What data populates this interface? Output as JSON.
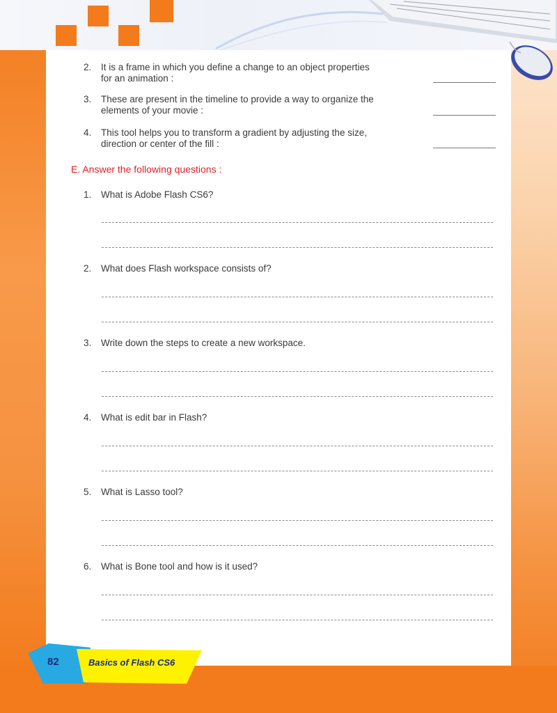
{
  "fill_blanks": [
    {
      "number": "2.",
      "line1": "It is a frame in which you define a change to an object properties",
      "line2": "for an animation :"
    },
    {
      "number": "3.",
      "line1": "These are present in the timeline to provide a way to organize the",
      "line2": "elements of your movie :"
    },
    {
      "number": "4.",
      "line1": "This tool helps you to transform a gradient by adjusting the size,",
      "line2": "direction or center of the fill :"
    }
  ],
  "section_e": {
    "label": "E.  Answer the following questions :",
    "questions": [
      {
        "number": "1.",
        "text": "What is Adobe Flash CS6?"
      },
      {
        "number": "2.",
        "text": "What does Flash workspace consists of?"
      },
      {
        "number": "3.",
        "text": "Write down the steps to create a new workspace."
      },
      {
        "number": "4.",
        "text": "What is edit bar in Flash?"
      },
      {
        "number": "5.",
        "text": "What is Lasso tool?"
      },
      {
        "number": "6.",
        "text": "What is Bone tool and how is it used?"
      }
    ]
  },
  "footer": {
    "page_number": "82",
    "book_title": "Basics of Flash CS6"
  },
  "colors": {
    "accent_orange": "#f37b1c",
    "section_red": "#e21f26",
    "footer_yellow": "#fff200",
    "footer_blue": "#29a9e1"
  }
}
